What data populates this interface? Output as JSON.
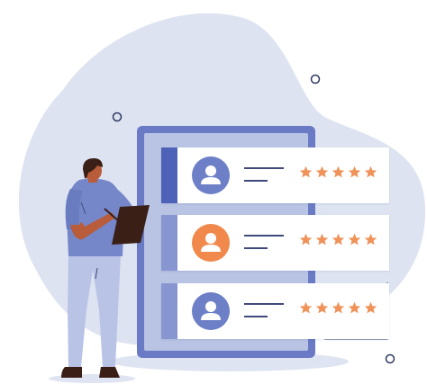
{
  "scene": {
    "description_free": true
  },
  "colors": {
    "blob": "#dde3f1",
    "tablet_frame": "#6b7ac4",
    "tablet_inner": "#b9c3e3",
    "stripe_primary": "#4e62b8",
    "stripe_secondary": "#8796d0",
    "avatar_blue": "#6d7fc6",
    "avatar_orange": "#f0894b",
    "star": "#f0935b",
    "shirt": "#7587c9",
    "pants": "#b8c3e6",
    "skin": "#b85c3a",
    "hair": "#3a1f17",
    "clipboard": "#3a1f17",
    "shoes": "#3a1f17"
  },
  "cards": [
    {
      "avatar_color": "#6d7fc6",
      "stripe_color": "#4e62b8",
      "rating": 5
    },
    {
      "avatar_color": "#f0894b",
      "stripe_color": "#8796d0",
      "rating": 5
    },
    {
      "avatar_color": "#6d7fc6",
      "stripe_color": "#8796d0",
      "rating": 5
    }
  ],
  "icons": [
    "user-avatar-icon",
    "star-icon",
    "clipboard-icon"
  ]
}
